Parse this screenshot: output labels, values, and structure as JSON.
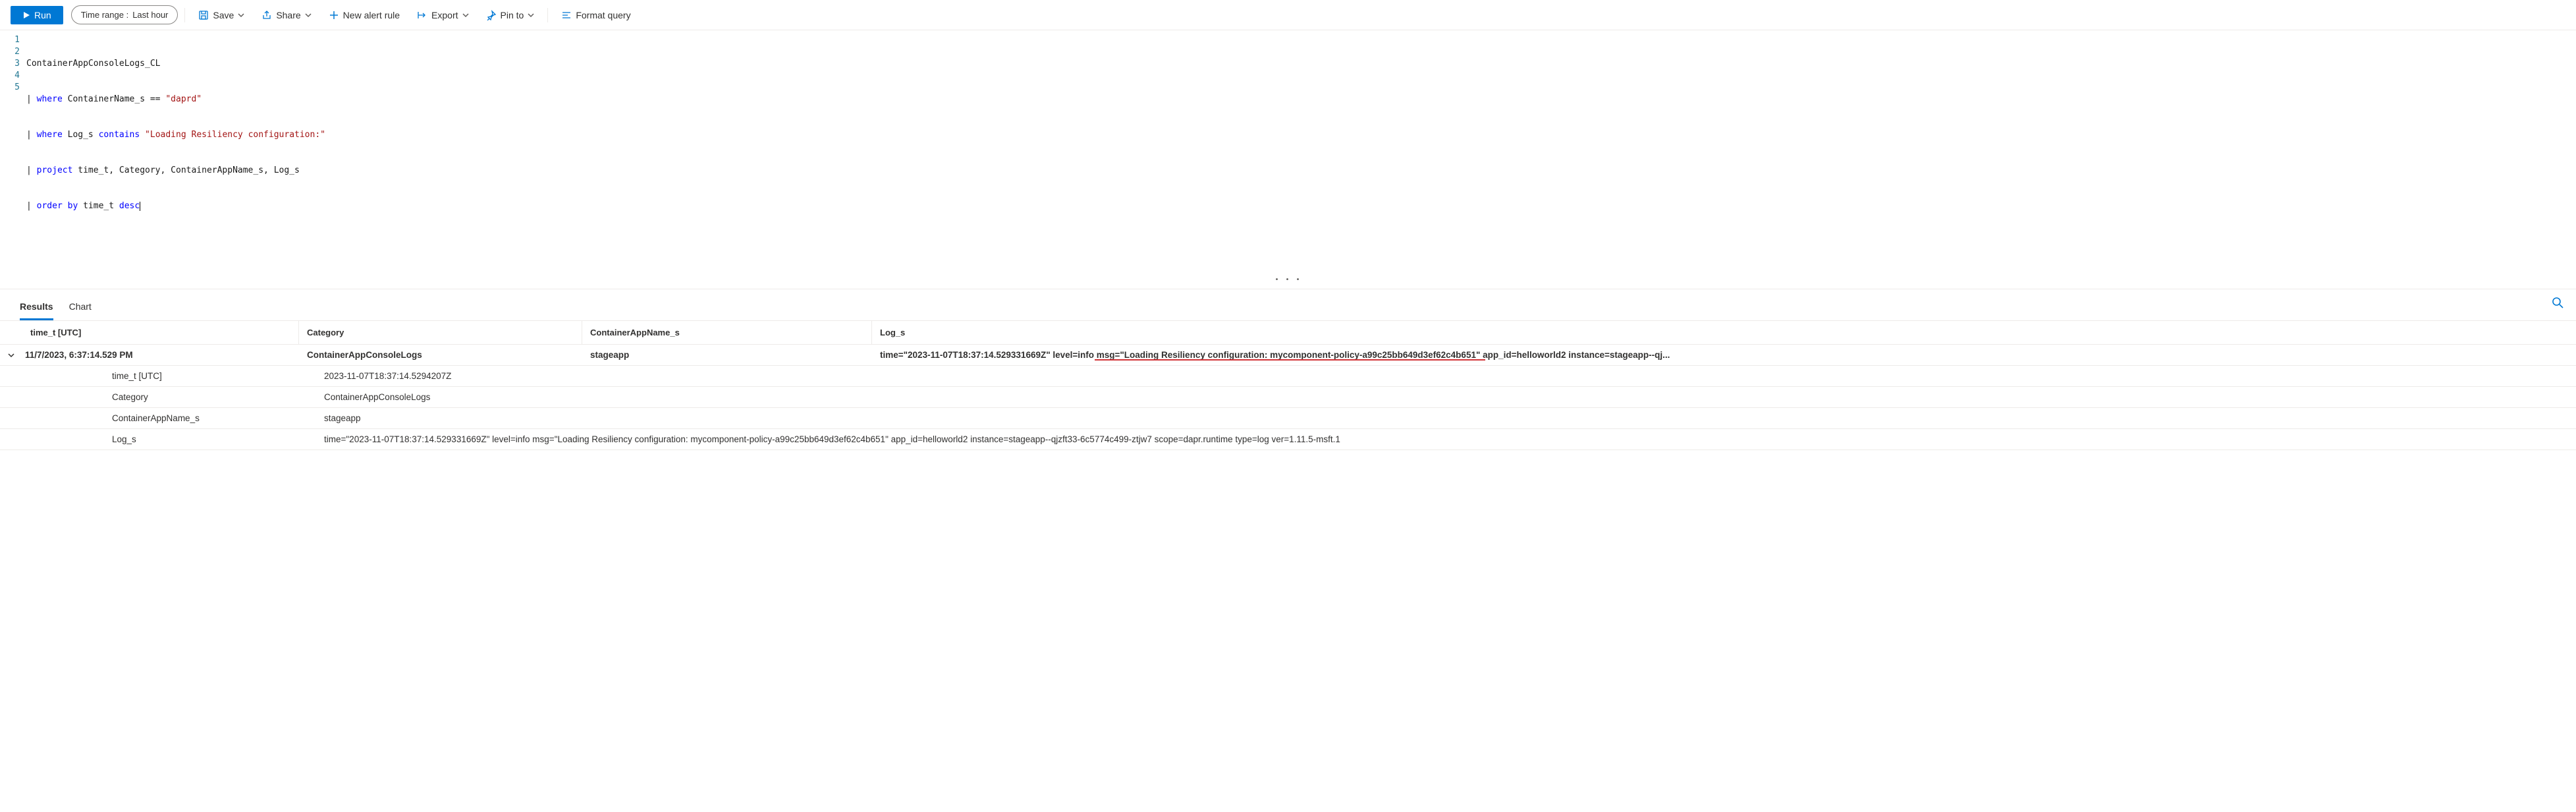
{
  "toolbar": {
    "run_label": "Run",
    "time_range_prefix": "Time range :",
    "time_range_value": "Last hour",
    "save_label": "Save",
    "share_label": "Share",
    "new_alert_label": "New alert rule",
    "export_label": "Export",
    "pin_label": "Pin to",
    "format_label": "Format query"
  },
  "editor": {
    "lines": [
      "1",
      "2",
      "3",
      "4",
      "5"
    ],
    "l1_t1": "ContainerAppConsoleLogs_CL",
    "l2_pipe": "|",
    "l2_kw": "where",
    "l2_id": "ContainerName_s",
    "l2_op": "==",
    "l2_str": "\"daprd\"",
    "l3_pipe": "|",
    "l3_kw": "where",
    "l3_id": "Log_s",
    "l3_kw2": "contains",
    "l3_str": "\"Loading Resiliency configuration:\"",
    "l4_pipe": "|",
    "l4_kw": "project",
    "l4_rest": "time_t, Category, ContainerAppName_s, Log_s",
    "l5_pipe": "|",
    "l5_kw": "order by",
    "l5_id": "time_t",
    "l5_kw2": "desc"
  },
  "tabs": {
    "results": "Results",
    "chart": "Chart"
  },
  "columns": {
    "time": "time_t [UTC]",
    "category": "Category",
    "app": "ContainerAppName_s",
    "log": "Log_s"
  },
  "row": {
    "time": "11/7/2023, 6:37:14.529 PM",
    "category": "ContainerAppConsoleLogs",
    "app": "stageapp",
    "log_summary": "time=\"2023-11-07T18:37:14.529331669Z\" level=info msg=\"Loading Resiliency configuration: mycomponent-policy-a99c25bb649d3ef62c4b651\" app_id=helloworld2 instance=stageapp--qj..."
  },
  "details": {
    "k_time": "time_t [UTC]",
    "v_time": "2023-11-07T18:37:14.5294207Z",
    "k_cat": "Category",
    "v_cat": "ContainerAppConsoleLogs",
    "k_app": "ContainerAppName_s",
    "v_app": "stageapp",
    "k_log": "Log_s",
    "v_log": "time=\"2023-11-07T18:37:14.529331669Z\" level=info msg=\"Loading Resiliency configuration: mycomponent-policy-a99c25bb649d3ef62c4b651\" app_id=helloworld2 instance=stageapp--qjzft33-6c5774c499-ztjw7 scope=dapr.runtime type=log ver=1.11.5-msft.1"
  }
}
